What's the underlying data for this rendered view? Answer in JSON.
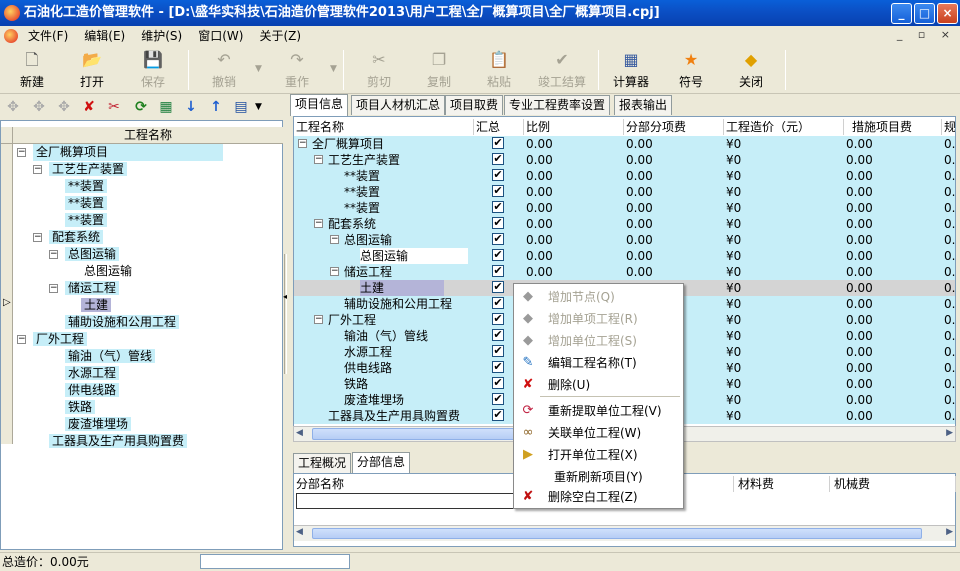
{
  "window": {
    "title": "石油化工造价管理软件 - [D:\\盛华实科技\\石油造价管理软件2013\\用户工程\\全厂概算项目\\全厂概算项目.cpj]",
    "minimize": "_",
    "maximize": "□",
    "close": "×"
  },
  "menu": [
    "文件(F)",
    "编辑(E)",
    "维护(S)",
    "窗口(W)",
    "关于(Z)"
  ],
  "mdi_controls": "_ ▫ ×",
  "toolbar": {
    "new": "新建",
    "open": "打开",
    "save": "保存",
    "undo": "撤销",
    "redo": "重作",
    "cut": "剪切",
    "copy": "复制",
    "paste": "粘贴",
    "settle": "竣工结算",
    "calculator": "计算器",
    "symbol": "符号",
    "close": "关闭"
  },
  "left_tree": {
    "header": "工程名称",
    "items": [
      {
        "label": "全厂概算项目",
        "exp": "−"
      },
      {
        "label": "工艺生产装置",
        "exp": "−"
      },
      {
        "label": "**装置",
        "exp": ""
      },
      {
        "label": "**装置",
        "exp": ""
      },
      {
        "label": "**装置",
        "exp": ""
      },
      {
        "label": "配套系统",
        "exp": "−"
      },
      {
        "label": "总图运输",
        "exp": "−"
      },
      {
        "label": "总图运输",
        "exp": ""
      },
      {
        "label": "储运工程",
        "exp": "−"
      },
      {
        "label": "土建",
        "exp": ""
      },
      {
        "label": "辅助设施和公用工程",
        "exp": ""
      },
      {
        "label": "厂外工程",
        "exp": "−"
      },
      {
        "label": "输油（气）管线",
        "exp": ""
      },
      {
        "label": "水源工程",
        "exp": ""
      },
      {
        "label": "供电线路",
        "exp": ""
      },
      {
        "label": "铁路",
        "exp": ""
      },
      {
        "label": "废渣堆埋场",
        "exp": ""
      },
      {
        "label": "工器具及生产用具购置费",
        "exp": ""
      }
    ]
  },
  "tabs": [
    "项目信息",
    "项目人材机汇总",
    "项目取费",
    "专业工程费率设置",
    "报表输出"
  ],
  "grid": {
    "columns": [
      "工程名称",
      "汇总",
      "比例",
      "分部分项费",
      "工程造价（元）",
      "措施项目费",
      "规"
    ],
    "rows": [
      {
        "name": "全厂概算项目",
        "exp": "−",
        "check": "✔",
        "ratio": "0.00",
        "fenbu": "0.00",
        "cost": "¥0",
        "measure": "0.00",
        "extra": "0."
      },
      {
        "name": "工艺生产装置",
        "exp": "−",
        "check": "✔",
        "ratio": "0.00",
        "fenbu": "0.00",
        "cost": "¥0",
        "measure": "0.00",
        "extra": "0."
      },
      {
        "name": "**装置",
        "exp": "",
        "check": "✔",
        "ratio": "0.00",
        "fenbu": "0.00",
        "cost": "¥0",
        "measure": "0.00",
        "extra": "0."
      },
      {
        "name": "**装置",
        "exp": "",
        "check": "✔",
        "ratio": "0.00",
        "fenbu": "0.00",
        "cost": "¥0",
        "measure": "0.00",
        "extra": "0."
      },
      {
        "name": "**装置",
        "exp": "",
        "check": "✔",
        "ratio": "0.00",
        "fenbu": "0.00",
        "cost": "¥0",
        "measure": "0.00",
        "extra": "0."
      },
      {
        "name": "配套系统",
        "exp": "−",
        "check": "✔",
        "ratio": "0.00",
        "fenbu": "0.00",
        "cost": "¥0",
        "measure": "0.00",
        "extra": "0."
      },
      {
        "name": "总图运输",
        "exp": "−",
        "check": "✔",
        "ratio": "0.00",
        "fenbu": "0.00",
        "cost": "¥0",
        "measure": "0.00",
        "extra": "0."
      },
      {
        "name": "总图运输",
        "exp": "",
        "check": "✔",
        "ratio": "0.00",
        "fenbu": "0.00",
        "cost": "¥0",
        "measure": "0.00",
        "extra": "0."
      },
      {
        "name": "储运工程",
        "exp": "−",
        "check": "✔",
        "ratio": "0.00",
        "fenbu": "0.00",
        "cost": "¥0",
        "measure": "0.00",
        "extra": "0."
      },
      {
        "name": "土建",
        "exp": "",
        "check": "✔",
        "ratio": "",
        "fenbu": "",
        "cost": "¥0",
        "measure": "0.00",
        "extra": "0."
      },
      {
        "name": "辅助设施和公用工程",
        "exp": "",
        "check": "✔",
        "ratio": "",
        "fenbu": "",
        "cost": "¥0",
        "measure": "0.00",
        "extra": "0."
      },
      {
        "name": "厂外工程",
        "exp": "−",
        "check": "✔",
        "ratio": "",
        "fenbu": "",
        "cost": "¥0",
        "measure": "0.00",
        "extra": "0."
      },
      {
        "name": "输油（气）管线",
        "exp": "",
        "check": "✔",
        "ratio": "",
        "fenbu": "",
        "cost": "¥0",
        "measure": "0.00",
        "extra": "0."
      },
      {
        "name": "水源工程",
        "exp": "",
        "check": "✔",
        "ratio": "",
        "fenbu": "",
        "cost": "¥0",
        "measure": "0.00",
        "extra": "0."
      },
      {
        "name": "供电线路",
        "exp": "",
        "check": "✔",
        "ratio": "",
        "fenbu": "",
        "cost": "¥0",
        "measure": "0.00",
        "extra": "0."
      },
      {
        "name": "铁路",
        "exp": "",
        "check": "✔",
        "ratio": "",
        "fenbu": "",
        "cost": "¥0",
        "measure": "0.00",
        "extra": "0."
      },
      {
        "name": "废渣堆埋场",
        "exp": "",
        "check": "✔",
        "ratio": "",
        "fenbu": "",
        "cost": "¥0",
        "measure": "0.00",
        "extra": "0."
      },
      {
        "name": "工器具及生产用具购置费",
        "exp": "",
        "check": "✔",
        "ratio": "",
        "fenbu": "",
        "cost": "¥0",
        "measure": "0.00",
        "extra": "0."
      }
    ]
  },
  "bottom": {
    "tabs": [
      "工程概况",
      "分部信息"
    ],
    "columns": [
      "分部名称",
      "材料费",
      "机械费"
    ]
  },
  "context_menu": [
    {
      "label": "增加节点(Q)",
      "icon": "◆",
      "disabled": true
    },
    {
      "label": "增加单项工程(R)",
      "icon": "◆",
      "disabled": true
    },
    {
      "label": "增加单位工程(S)",
      "icon": "◆",
      "disabled": true
    },
    {
      "label": "编辑工程名称(T)",
      "icon": "✎",
      "disabled": false
    },
    {
      "label": "删除(U)",
      "icon": "✘",
      "disabled": false
    },
    {
      "label": "重新提取单位工程(V)",
      "icon": "⟳",
      "disabled": false
    },
    {
      "label": "关联单位工程(W)",
      "icon": "∞",
      "disabled": false
    },
    {
      "label": "打开单位工程(X)",
      "icon": "▶",
      "disabled": false
    },
    {
      "label": "重新刷新项目(Y)",
      "icon": "",
      "disabled": false
    },
    {
      "label": "删除空白工程(Z)",
      "icon": "✘",
      "disabled": false
    }
  ],
  "status": {
    "total": "总造价：0.00元"
  },
  "colors": {
    "titlebar": "#0a5fd8",
    "row_highlight": "#c6eef8",
    "selected": "#b4b4d8",
    "delete_red": "#d01010"
  }
}
